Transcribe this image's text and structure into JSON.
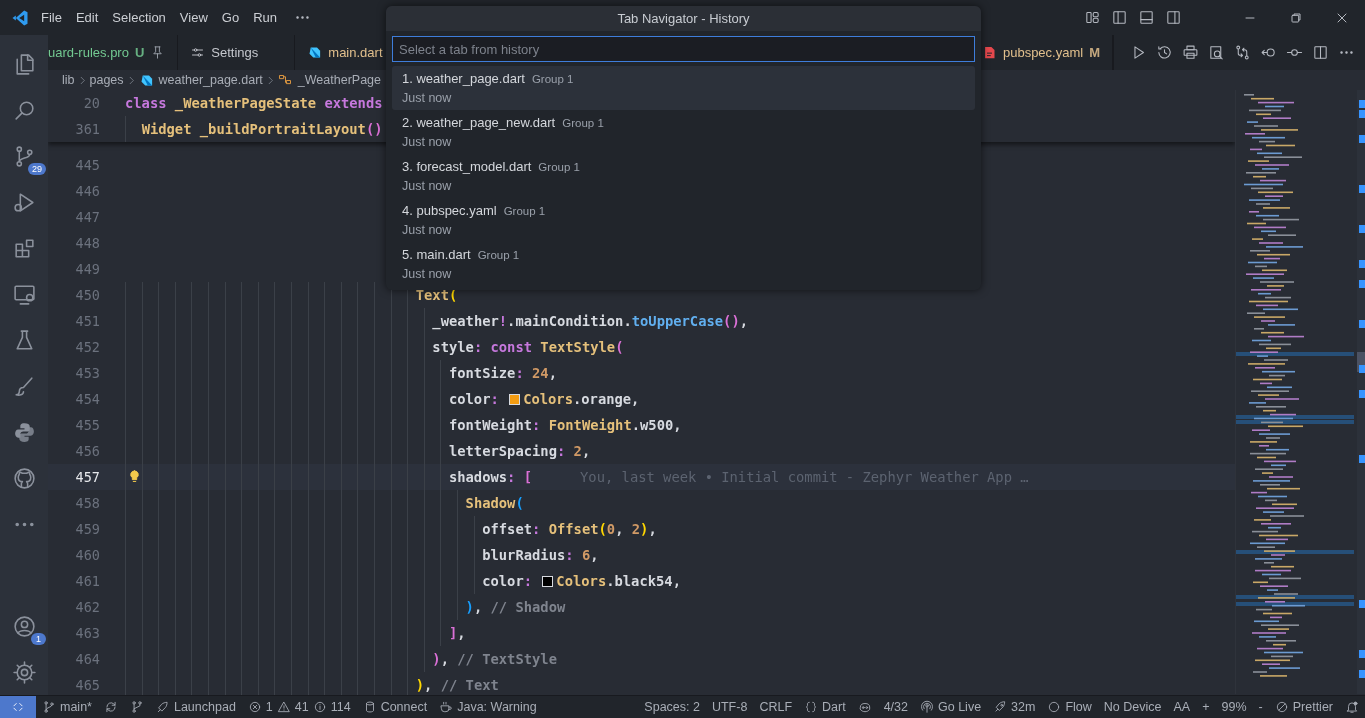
{
  "title_bar": {
    "menu": [
      "File",
      "Edit",
      "Selection",
      "View",
      "Go",
      "Run"
    ]
  },
  "activity_bar": {
    "scm_badge": "29",
    "accounts_badge": "1"
  },
  "tabs": [
    {
      "label": "uard-rules.pro",
      "badge": "U",
      "kind": "file",
      "color": "#73c991",
      "pinned": true
    },
    {
      "label": "Settings",
      "kind": "settings",
      "pinned": false
    },
    {
      "label": "main.dart",
      "kind": "dart",
      "color": "#e2c08d",
      "pinned": false
    },
    {
      "label": "pubspec.yaml",
      "badge": "M",
      "kind": "yaml",
      "color": "#e2c08d",
      "pinned": false
    }
  ],
  "breadcrumb": [
    {
      "label": "lib",
      "kind": "folder"
    },
    {
      "label": "pages",
      "kind": "folder"
    },
    {
      "label": "weather_page.dart",
      "kind": "dart"
    },
    {
      "label": "_WeatherPage",
      "kind": "symbol"
    }
  ],
  "editor": {
    "sticky_lines": [
      {
        "num": "20",
        "tokens": [
          {
            "kind": "kw",
            "text": "class"
          },
          {
            "kind": "type",
            "text": " _WeatherPageState "
          },
          {
            "kind": "kw",
            "text": "extends"
          }
        ]
      },
      {
        "num": "361",
        "tokens": [
          {
            "kind": "type",
            "text": "  Widget _buildPortraitLayout"
          },
          {
            "kind": "p2",
            "text": "()"
          }
        ]
      }
    ],
    "lines": [
      {
        "num": "445",
        "current": false,
        "lightbulb": false
      },
      {
        "num": "446",
        "current": false,
        "lightbulb": false
      },
      {
        "num": "447",
        "current": false,
        "lightbulb": false
      },
      {
        "num": "448",
        "current": false,
        "lightbulb": false
      },
      {
        "num": "449",
        "current": false,
        "lightbulb": false
      },
      {
        "num": "450",
        "current": false,
        "lightbulb": false,
        "tokens": [
          {
            "kind": "type",
            "text": "                                   Text"
          },
          {
            "kind": "p1",
            "text": "("
          }
        ]
      },
      {
        "num": "451",
        "current": false,
        "lightbulb": false,
        "tokens": [
          {
            "kind": "plain",
            "text": "                                     _weather"
          },
          {
            "kind": "kw",
            "text": "!"
          },
          {
            "kind": "plain",
            "text": ".mainCondition."
          },
          {
            "kind": "fn",
            "text": "toUpperCase"
          },
          {
            "kind": "p2",
            "text": "()"
          },
          {
            "kind": "plain",
            "text": ","
          }
        ]
      },
      {
        "num": "452",
        "current": false,
        "lightbulb": false,
        "tokens": [
          {
            "kind": "plain",
            "text": "                                     style"
          },
          {
            "kind": "op",
            "text": ":"
          },
          {
            "kind": "kw",
            "text": " const "
          },
          {
            "kind": "type",
            "text": "TextStyle"
          },
          {
            "kind": "p2",
            "text": "("
          }
        ]
      },
      {
        "num": "453",
        "current": false,
        "lightbulb": false,
        "tokens": [
          {
            "kind": "plain",
            "text": "                                       fontSize"
          },
          {
            "kind": "op",
            "text": ":"
          },
          {
            "kind": "num",
            "text": " 24"
          },
          {
            "kind": "plain",
            "text": ","
          }
        ]
      },
      {
        "num": "454",
        "current": false,
        "lightbulb": false,
        "tokens": [
          {
            "kind": "plain",
            "text": "                                       color"
          },
          {
            "kind": "op",
            "text": ": "
          },
          {
            "kind": "swatch",
            "color": "#f39c12"
          },
          {
            "kind": "type",
            "text": "Colors"
          },
          {
            "kind": "plain",
            "text": ".orange,"
          }
        ]
      },
      {
        "num": "455",
        "current": false,
        "lightbulb": false,
        "tokens": [
          {
            "kind": "plain",
            "text": "                                       fontWeight"
          },
          {
            "kind": "op",
            "text": ": "
          },
          {
            "kind": "type",
            "text": "FontWeight"
          },
          {
            "kind": "plain",
            "text": ".w500,"
          }
        ]
      },
      {
        "num": "456",
        "current": false,
        "lightbulb": false,
        "tokens": [
          {
            "kind": "plain",
            "text": "                                       letterSpacing"
          },
          {
            "kind": "op",
            "text": ":"
          },
          {
            "kind": "num",
            "text": " 2"
          },
          {
            "kind": "plain",
            "text": ","
          }
        ]
      },
      {
        "num": "457",
        "current": true,
        "lightbulb": true,
        "tokens": [
          {
            "kind": "plain",
            "text": "                                       shadows"
          },
          {
            "kind": "op",
            "text": ": "
          },
          {
            "kind": "p2",
            "text": "["
          }
        ],
        "blame": "You, last week • Initial commit - Zephyr Weather App …"
      },
      {
        "num": "458",
        "current": false,
        "lightbulb": false,
        "tokens": [
          {
            "kind": "type",
            "text": "                                         Shadow"
          },
          {
            "kind": "p3",
            "text": "("
          }
        ]
      },
      {
        "num": "459",
        "current": false,
        "lightbulb": false,
        "tokens": [
          {
            "kind": "plain",
            "text": "                                           offset"
          },
          {
            "kind": "op",
            "text": ": "
          },
          {
            "kind": "type",
            "text": "Offset"
          },
          {
            "kind": "p1",
            "text": "("
          },
          {
            "kind": "num",
            "text": "0"
          },
          {
            "kind": "plain",
            "text": ", "
          },
          {
            "kind": "num",
            "text": "2"
          },
          {
            "kind": "p1",
            "text": ")"
          },
          {
            "kind": "plain",
            "text": ","
          }
        ]
      },
      {
        "num": "460",
        "current": false,
        "lightbulb": false,
        "tokens": [
          {
            "kind": "plain",
            "text": "                                           blurRadius"
          },
          {
            "kind": "op",
            "text": ":"
          },
          {
            "kind": "num",
            "text": " 6"
          },
          {
            "kind": "plain",
            "text": ","
          }
        ]
      },
      {
        "num": "461",
        "current": false,
        "lightbulb": false,
        "tokens": [
          {
            "kind": "plain",
            "text": "                                           color"
          },
          {
            "kind": "op",
            "text": ": "
          },
          {
            "kind": "swatch",
            "color": "#000000"
          },
          {
            "kind": "type",
            "text": "Colors"
          },
          {
            "kind": "plain",
            "text": ".black54,"
          }
        ]
      },
      {
        "num": "462",
        "current": false,
        "lightbulb": false,
        "tokens": [
          {
            "kind": "p3",
            "text": "                                         )"
          },
          {
            "kind": "plain",
            "text": ", "
          },
          {
            "kind": "cmt",
            "text": "// Shadow"
          }
        ]
      },
      {
        "num": "463",
        "current": false,
        "lightbulb": false,
        "tokens": [
          {
            "kind": "p2",
            "text": "                                       ]"
          },
          {
            "kind": "plain",
            "text": ","
          }
        ]
      },
      {
        "num": "464",
        "current": false,
        "lightbulb": false,
        "tokens": [
          {
            "kind": "p2",
            "text": "                                     )"
          },
          {
            "kind": "plain",
            "text": ", "
          },
          {
            "kind": "cmt",
            "text": "// TextStyle"
          }
        ]
      },
      {
        "num": "465",
        "current": false,
        "lightbulb": false,
        "tokens": [
          {
            "kind": "p1",
            "text": "                                   )"
          },
          {
            "kind": "plain",
            "text": ", "
          },
          {
            "kind": "cmt",
            "text": "// Text"
          }
        ]
      }
    ]
  },
  "quick_pick": {
    "title": "Tab Navigator - History",
    "placeholder": "Select a tab from history",
    "items": [
      {
        "label": "1. weather_page.dart",
        "description": "Group 1",
        "detail": "Just now",
        "selected": true
      },
      {
        "label": "2. weather_page_new.dart",
        "description": "Group 1",
        "detail": "Just now",
        "selected": false
      },
      {
        "label": "3. forecast_model.dart",
        "description": "Group 1",
        "detail": "Just now",
        "selected": false
      },
      {
        "label": "4. pubspec.yaml",
        "description": "Group 1",
        "detail": "Just now",
        "selected": false
      },
      {
        "label": "5. main.dart",
        "description": "Group 1",
        "detail": "Just now",
        "selected": false
      }
    ]
  },
  "status_bar": {
    "left": [
      {
        "kind": "remote"
      },
      {
        "kind": "branch",
        "text": "main*"
      },
      {
        "kind": "sync"
      },
      {
        "kind": "graph"
      },
      {
        "kind": "launchpad",
        "text": "Launchpad"
      },
      {
        "kind": "problems",
        "errors": "1",
        "warnings": "41",
        "infos": "114"
      },
      {
        "kind": "database",
        "text": "Connect"
      },
      {
        "kind": "java",
        "text": "Java: Warning"
      }
    ],
    "right": [
      {
        "kind": "text",
        "text": "Spaces: 2"
      },
      {
        "kind": "text",
        "text": "UTF-8"
      },
      {
        "kind": "text",
        "text": "CRLF"
      },
      {
        "kind": "braces",
        "text": "Dart"
      },
      {
        "kind": "copilot"
      },
      {
        "kind": "text",
        "text": "4/32"
      },
      {
        "kind": "broadcast",
        "text": "Go Live"
      },
      {
        "kind": "rocket",
        "text": "32m"
      },
      {
        "kind": "circle",
        "text": "Flow"
      },
      {
        "kind": "text",
        "text": "No Device"
      },
      {
        "kind": "text",
        "text": "AA"
      },
      {
        "kind": "text",
        "text": "+"
      },
      {
        "kind": "text",
        "text": "99%"
      },
      {
        "kind": "text",
        "text": "-"
      },
      {
        "kind": "prettier",
        "text": "Prettier"
      },
      {
        "kind": "bell"
      }
    ]
  }
}
